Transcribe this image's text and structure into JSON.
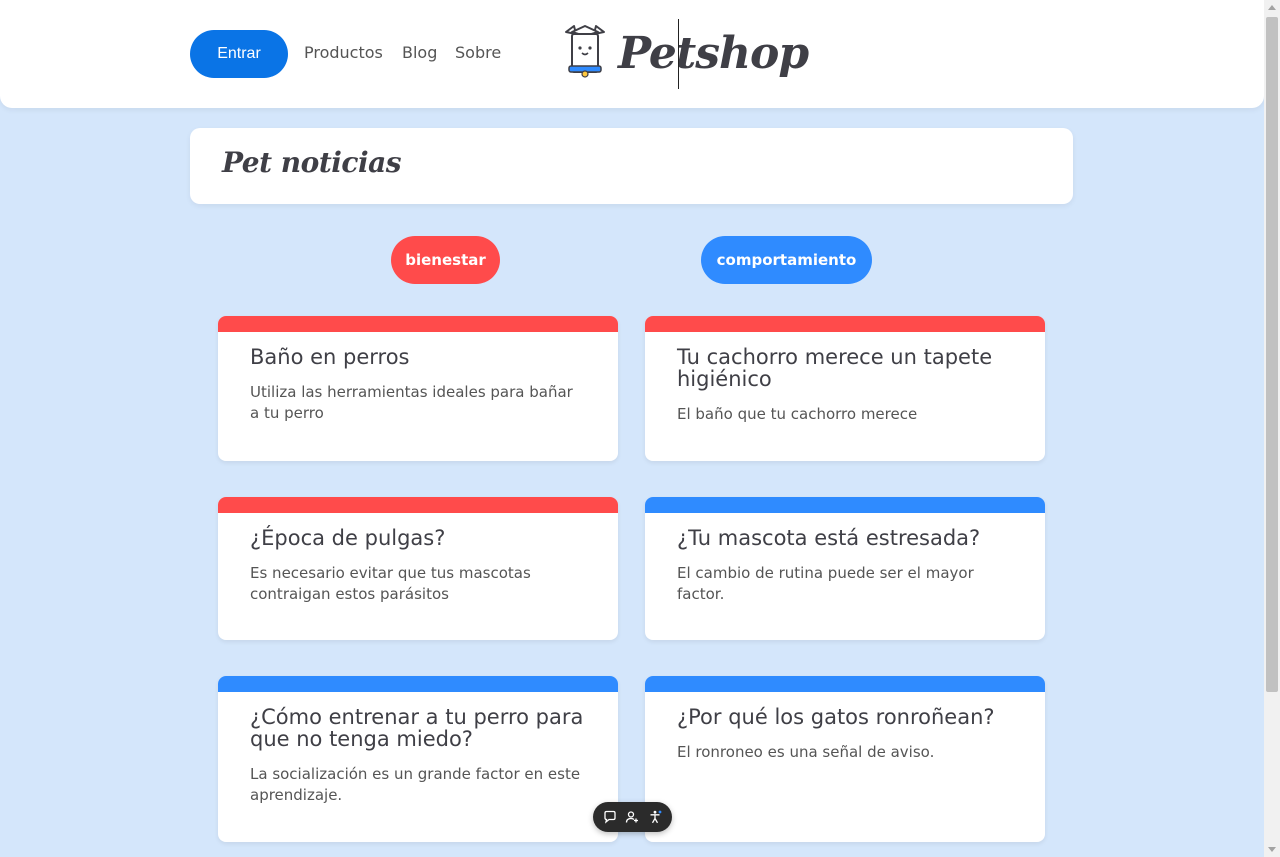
{
  "header": {
    "login_label": "Entrar",
    "nav": [
      "Productos",
      "Blog",
      "Sobre"
    ],
    "logo_text": "Petshop"
  },
  "page": {
    "title": "Pet noticias"
  },
  "filters": [
    {
      "label": "bienestar",
      "color": "#ff4b4b"
    },
    {
      "label": "comportamiento",
      "color": "#2f8bff"
    }
  ],
  "cards": [
    {
      "title": "Baño en perros",
      "description": "Utiliza las herramientas ideales para bañar a tu perro",
      "category": "bienestar"
    },
    {
      "title": "Tu cachorro merece un tapete higiénico",
      "description": "El baño que tu cachorro merece",
      "category": "bienestar"
    },
    {
      "title": "¿Época de pulgas?",
      "description": "Es necesario evitar que tus mascotas contraigan estos parásitos",
      "category": "bienestar"
    },
    {
      "title": "¿Tu mascota está estresada?",
      "description": "El cambio de rutina puede ser el mayor factor.",
      "category": "comportamiento"
    },
    {
      "title": "¿Cómo entrenar a tu perro para que no tenga miedo?",
      "description": "La socialización es un grande factor en este aprendizaje.",
      "category": "comportamiento"
    },
    {
      "title": "¿Por qué los gatos ronroñean?",
      "description": "El ronroneo es una señal de aviso.",
      "category": "comportamiento"
    }
  ],
  "toolbar_icons": [
    "chat-bubble-icon",
    "add-user-icon",
    "accessibility-icon"
  ],
  "colors": {
    "primary": "#0a74e6",
    "bienestar": "#ff4b4b",
    "comportamiento": "#2f8bff",
    "background": "#d4e6fb"
  }
}
